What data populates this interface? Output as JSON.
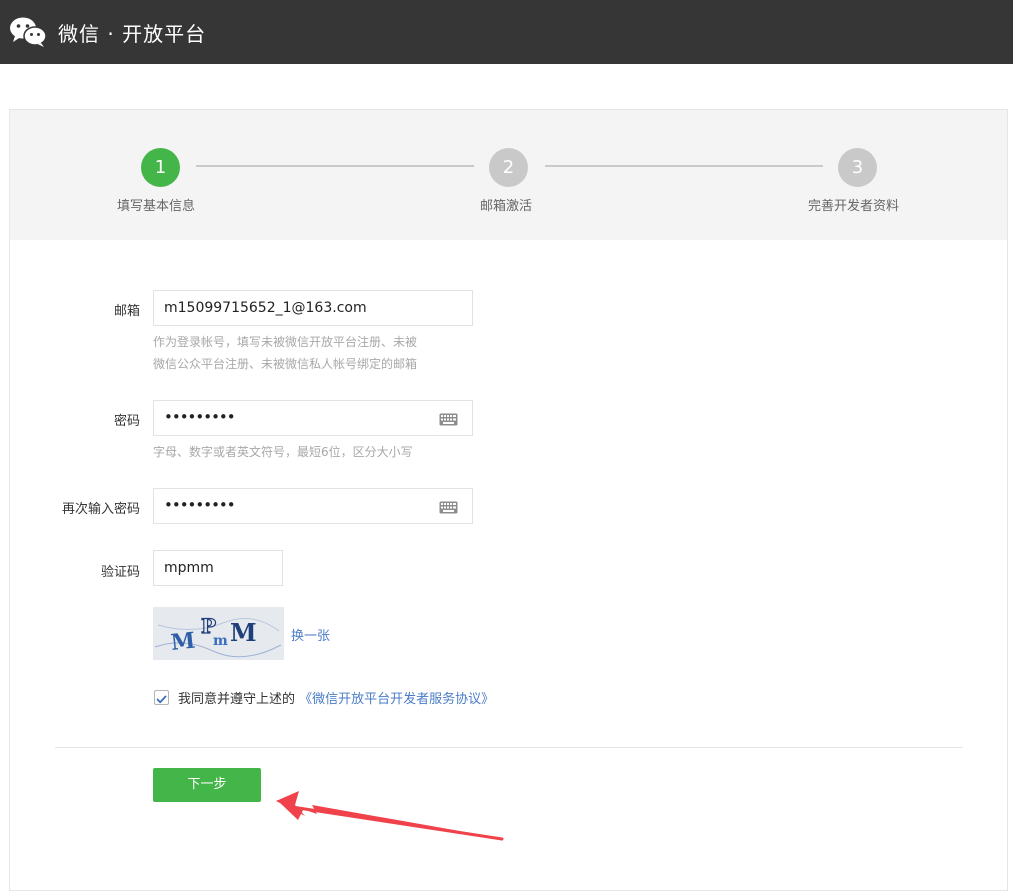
{
  "header": {
    "title": "微信 · 开放平台",
    "logo_icon": "wechat-logo-icon"
  },
  "steps": [
    {
      "number": "1",
      "label": "填写基本信息",
      "state": "active"
    },
    {
      "number": "2",
      "label": "邮箱激活",
      "state": "inactive"
    },
    {
      "number": "3",
      "label": "完善开发者资料",
      "state": "inactive"
    }
  ],
  "form": {
    "email": {
      "label": "邮箱",
      "value": "m15099715652_1@163.com",
      "hint_line1": "作为登录帐号，填写未被微信开放平台注册、未被",
      "hint_line2": "微信公众平台注册、未被微信私人帐号绑定的邮箱"
    },
    "password": {
      "label": "密码",
      "value": "•••••••••",
      "hint": "字母、数字或者英文符号，最短6位，区分大小写",
      "keyboard_icon": "keyboard-icon"
    },
    "password_confirm": {
      "label": "再次输入密码",
      "value": "•••••••••",
      "keyboard_icon": "keyboard-icon"
    },
    "captcha": {
      "label": "验证码",
      "value": "mpmm",
      "image_text": "MPM",
      "refresh_label": "换一张"
    },
    "agreement": {
      "checked": true,
      "text": "我同意并遵守上述的",
      "link": "《微信开放平台开发者服务协议》"
    },
    "next_button": "下一步"
  },
  "colors": {
    "topbar": "#363636",
    "accent_green": "#44b549",
    "link_blue": "#4a7dc7",
    "inactive_gray": "#c9c9c9",
    "annotation_arrow": "#f0424a"
  }
}
